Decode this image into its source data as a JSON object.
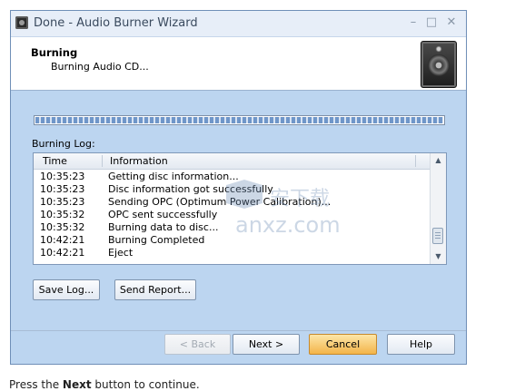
{
  "window": {
    "title": "Done  - Audio Burner Wizard",
    "controls": {
      "minimize": "–",
      "maximize": "□",
      "close": "✕"
    }
  },
  "header": {
    "title": "Burning",
    "subtitle": "Burning Audio CD..."
  },
  "progress": {
    "value": 1.0,
    "color": "#6f96c9"
  },
  "log": {
    "label": "Burning Log:",
    "columns": [
      "Time",
      "Information"
    ],
    "rows": [
      {
        "time": "10:35:23",
        "info": "Getting disc information..."
      },
      {
        "time": "10:35:23",
        "info": "Disc information got successfully"
      },
      {
        "time": "10:35:23",
        "info": "Sending OPC (Optimum Power Calibration)..."
      },
      {
        "time": "10:35:32",
        "info": "OPC sent successfully"
      },
      {
        "time": "10:35:32",
        "info": "Burning data to disc..."
      },
      {
        "time": "10:42:21",
        "info": "Burning Completed"
      },
      {
        "time": "10:42:21",
        "info": "Eject"
      }
    ]
  },
  "actions": {
    "save_log": "Save Log...",
    "send_report": "Send Report..."
  },
  "nav": {
    "back": "< Back",
    "next": "Next >",
    "cancel": "Cancel",
    "help": "Help"
  },
  "watermark": {
    "text": "anxz.com"
  },
  "caption": {
    "prefix": "Press the ",
    "bold": "Next",
    "suffix": " button to continue."
  },
  "colors": {
    "window_bg": "#bcd5f0",
    "cancel_accent": "#f3b44a"
  }
}
